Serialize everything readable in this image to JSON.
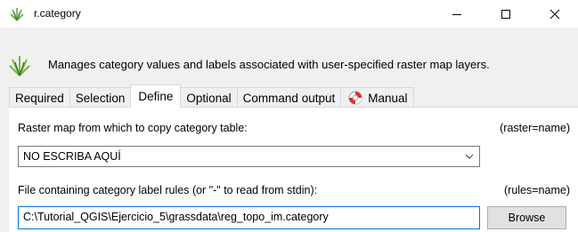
{
  "window": {
    "title": "r.category",
    "app_icon": "grass-icon",
    "controls": [
      "minimize-icon",
      "maximize-icon",
      "close-icon"
    ]
  },
  "header": {
    "description": "Manages category values and labels associated with user-specified raster map layers."
  },
  "tabs": [
    {
      "label": "Required",
      "active": false
    },
    {
      "label": "Selection",
      "active": false
    },
    {
      "label": "Define",
      "active": true
    },
    {
      "label": "Optional",
      "active": false
    },
    {
      "label": "Command output",
      "active": false
    },
    {
      "label": "Manual",
      "active": false,
      "icon": "lifebuoy-icon"
    }
  ],
  "form": {
    "raster": {
      "label": "Raster map from which to copy category table:",
      "param": "(raster=name)",
      "value": "NO ESCRIBA AQUÍ"
    },
    "rules": {
      "label": "File containing category label rules (or \"-\" to read from stdin):",
      "param": "(rules=name)",
      "value": "C:\\Tutorial_QGIS\\Ejercicio_5\\grassdata\\reg_topo_im.category",
      "browse_label": "Browse"
    }
  },
  "colors": {
    "focus_border": "#0078d7",
    "panel_bg": "#ffffff",
    "window_bg": "#f0f0f0"
  }
}
